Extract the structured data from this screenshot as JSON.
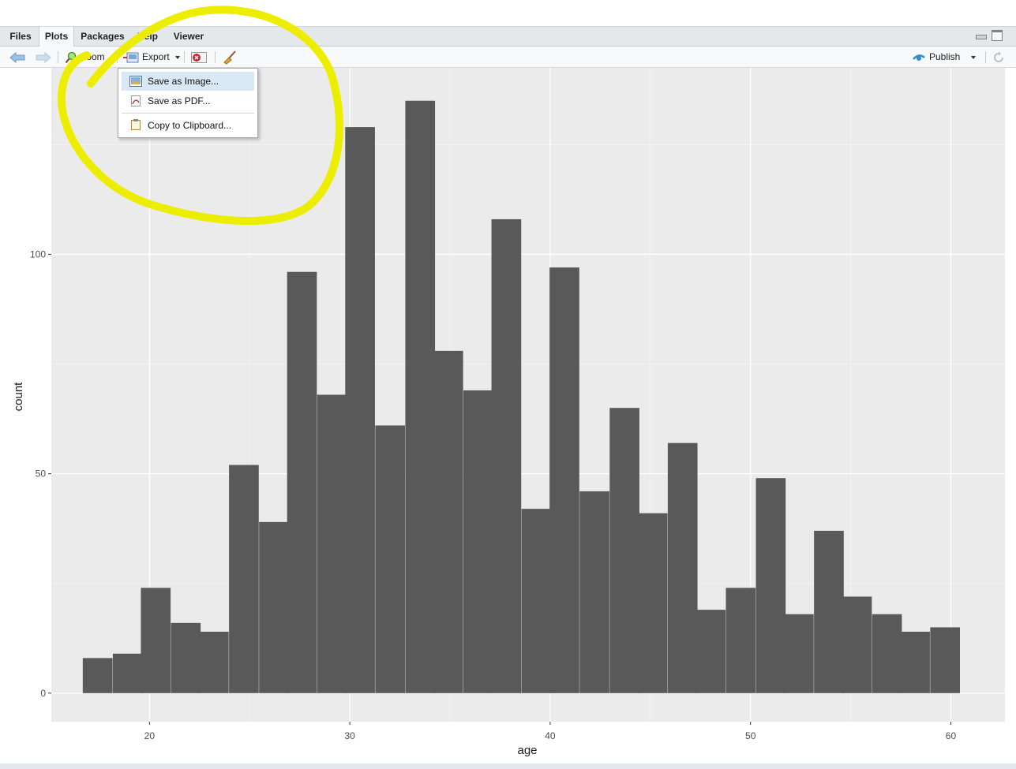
{
  "tabs": [
    {
      "label": "Files"
    },
    {
      "label": "Plots"
    },
    {
      "label": "Packages"
    },
    {
      "label": "Help"
    },
    {
      "label": "Viewer"
    }
  ],
  "toolbar": {
    "zoom_label": "Zoom",
    "export_label": "Export",
    "publish_label": "Publish"
  },
  "export_menu": {
    "items": [
      {
        "label": "Save as Image..."
      },
      {
        "label": "Save as PDF..."
      },
      {
        "label": "Copy to Clipboard..."
      }
    ]
  },
  "colors": {
    "panel_bg": "#ebebeb",
    "bar_fill": "#595959",
    "highlight": "#f0f000",
    "menu_hover": "#d9e8f5"
  },
  "chart_data": {
    "type": "bar",
    "title": "",
    "xlabel": "age",
    "ylabel": "count",
    "x_ticks": [
      20,
      30,
      40,
      50,
      60
    ],
    "y_ticks": [
      0,
      50,
      100
    ],
    "xlim": [
      15.1,
      62.7
    ],
    "ylim": [
      -6.5,
      142.5
    ],
    "bin_width": 1.46,
    "bins": [
      {
        "x": 17.4,
        "count": 8
      },
      {
        "x": 18.9,
        "count": 9
      },
      {
        "x": 20.3,
        "count": 24
      },
      {
        "x": 21.8,
        "count": 16
      },
      {
        "x": 23.2,
        "count": 14
      },
      {
        "x": 24.7,
        "count": 52
      },
      {
        "x": 26.2,
        "count": 39
      },
      {
        "x": 27.6,
        "count": 96
      },
      {
        "x": 29.1,
        "count": 68
      },
      {
        "x": 30.5,
        "count": 129
      },
      {
        "x": 32.0,
        "count": 61
      },
      {
        "x": 33.5,
        "count": 135
      },
      {
        "x": 34.9,
        "count": 78
      },
      {
        "x": 36.4,
        "count": 69
      },
      {
        "x": 37.8,
        "count": 108
      },
      {
        "x": 39.3,
        "count": 42
      },
      {
        "x": 40.7,
        "count": 97
      },
      {
        "x": 42.2,
        "count": 46
      },
      {
        "x": 43.7,
        "count": 65
      },
      {
        "x": 45.1,
        "count": 41
      },
      {
        "x": 46.6,
        "count": 57
      },
      {
        "x": 48.0,
        "count": 19
      },
      {
        "x": 49.5,
        "count": 24
      },
      {
        "x": 51.0,
        "count": 49
      },
      {
        "x": 52.4,
        "count": 18
      },
      {
        "x": 53.9,
        "count": 37
      },
      {
        "x": 55.3,
        "count": 22
      },
      {
        "x": 56.8,
        "count": 18
      },
      {
        "x": 58.2,
        "count": 14
      },
      {
        "x": 59.7,
        "count": 15
      }
    ],
    "grid": true,
    "legend": "none"
  }
}
